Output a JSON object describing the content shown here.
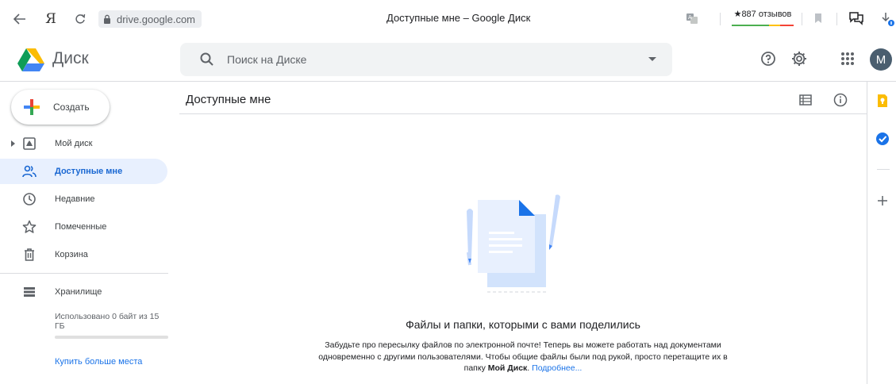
{
  "browser": {
    "ya_glyph": "Я",
    "url": "drive.google.com",
    "tab_title": "Доступные мне – Google Диск",
    "reviews": "★887 отзывов"
  },
  "header": {
    "brand": "Диск",
    "search_placeholder": "Поиск на Диске",
    "avatar_letter": "M"
  },
  "sidebar": {
    "create_label": "Создать",
    "items": [
      {
        "label": "Мой диск",
        "icon": "my-drive-icon"
      },
      {
        "label": "Доступные мне",
        "icon": "shared-icon"
      },
      {
        "label": "Недавние",
        "icon": "clock-icon"
      },
      {
        "label": "Помеченные",
        "icon": "star-icon"
      },
      {
        "label": "Корзина",
        "icon": "trash-icon"
      },
      {
        "label": "Хранилище",
        "icon": "storage-icon"
      }
    ],
    "usage_text": "Использовано 0 байт из 15 ГБ",
    "usage_fraction": 0.0,
    "buy_more": "Купить больше места"
  },
  "main": {
    "title": "Доступные мне",
    "empty_title": "Файлы и папки, которыми с вами поделились",
    "empty_desc_1": "Забудьте про пересылку файлов по электронной почте! Теперь вы можете работать над документами одновременно с другими пользователями. Чтобы общие файлы были под рукой, просто перетащите их в папку ",
    "empty_desc_bold": "Мой Диск",
    "empty_desc_2": ". ",
    "learn_more": "Подробнее..."
  },
  "colors": {
    "accent": "#1a73e8",
    "active_bg": "#e8f0fe",
    "keep": "#fbbc04",
    "tasks": "#1a73e8"
  }
}
